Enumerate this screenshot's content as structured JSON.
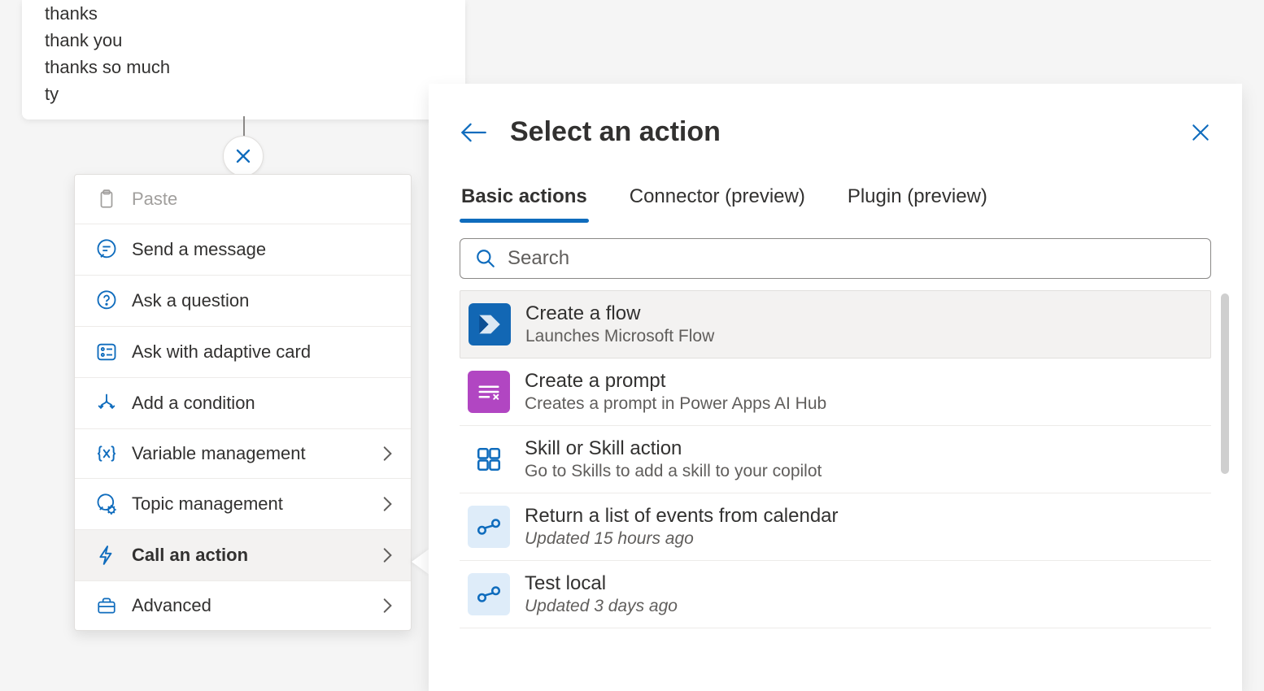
{
  "trigger_phrases": [
    "thanks",
    "thank you",
    "thanks so much",
    "ty"
  ],
  "context_menu": {
    "paste": "Paste",
    "send_message": "Send a message",
    "ask_question": "Ask a question",
    "ask_adaptive": "Ask with adaptive card",
    "add_condition": "Add a condition",
    "variable_mgmt": "Variable management",
    "topic_mgmt": "Topic management",
    "call_action": "Call an action",
    "advanced": "Advanced"
  },
  "panel": {
    "title": "Select an action",
    "tabs": {
      "basic": "Basic actions",
      "connector": "Connector (preview)",
      "plugin": "Plugin (preview)"
    },
    "search_placeholder": "Search",
    "actions": [
      {
        "title": "Create a flow",
        "sub": "Launches Microsoft Flow",
        "sub_italic": false
      },
      {
        "title": "Create a prompt",
        "sub": "Creates a prompt in Power Apps AI Hub",
        "sub_italic": false
      },
      {
        "title": "Skill or Skill action",
        "sub": "Go to Skills to add a skill to your copilot",
        "sub_italic": false
      },
      {
        "title": "Return a list of events from calendar",
        "sub": "Updated 15 hours ago",
        "sub_italic": true
      },
      {
        "title": "Test local",
        "sub": "Updated 3 days ago",
        "sub_italic": true
      }
    ]
  }
}
